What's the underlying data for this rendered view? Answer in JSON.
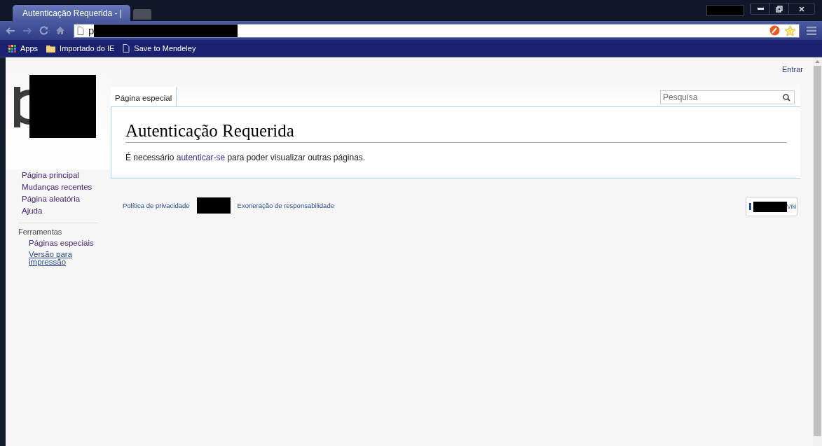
{
  "browser": {
    "tabs": [
      {
        "title": "Autenticação Requerida - |",
        "selected": true
      },
      {
        "selected": false
      }
    ],
    "address": "p",
    "bookmarks": [
      {
        "kind": "apps",
        "label": "Apps"
      },
      {
        "kind": "folder",
        "label": "Importado do IE"
      },
      {
        "kind": "page",
        "label": "Save to Mendeley"
      }
    ]
  },
  "page": {
    "personal": [
      {
        "label": "Entrar"
      }
    ],
    "sidebar": {
      "navigation": [
        {
          "label": "Página principal"
        },
        {
          "label": "Mudanças recentes"
        },
        {
          "label": "Página aleatória"
        },
        {
          "label": "Ajuda"
        }
      ],
      "tools_heading": "Ferramentas",
      "tools": [
        {
          "label": "Páginas especiais",
          "underlined": false
        },
        {
          "label": "Versão para impressão",
          "underlined": true
        }
      ]
    },
    "tabs": [
      {
        "label": "Página especial",
        "selected": true
      }
    ],
    "search": {
      "placeholder": "Pesquisa"
    },
    "heading": "Autenticação Requerida",
    "body": {
      "before": "É necessário ",
      "link": "autenticar-se",
      "after": " para poder visualizar outras páginas."
    },
    "footer_links": [
      {
        "kind": "link",
        "label": "Política de privacidade"
      },
      {
        "kind": "redacted"
      },
      {
        "kind": "link",
        "label": "Exoneração de responsabilidade"
      }
    ],
    "powered_by": "Viki"
  }
}
